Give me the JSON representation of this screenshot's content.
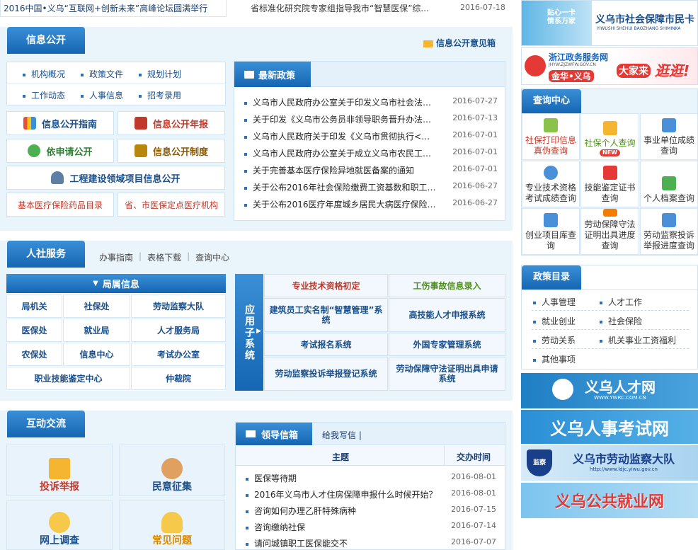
{
  "top": {
    "left_headline": "2016中国•义乌“互联网+创新未来”高峰论坛圆满举行",
    "mid_news": {
      "title": "省标准化研究院专家组指导我市“智慧医保”综...",
      "date": "2016-07-18"
    }
  },
  "info_public": {
    "title": "信息公开",
    "mailbox": "信息公开意见箱",
    "links_row1": [
      "机构概况",
      "政策文件",
      "规划计划"
    ],
    "links_row2": [
      "工作动态",
      "人事信息",
      "招考录用"
    ],
    "buttons": {
      "guide": "信息公开指南",
      "annual": "信息公开年报",
      "apply": "依申请公开",
      "system": "信息公开制度",
      "construction": "工程建设领域项目信息公开",
      "drug_catalog": "基本医疗保险药品目录",
      "hospitals": "省、市医保定点医疗机构"
    }
  },
  "latest_policy": {
    "title": "最新政策",
    "items": [
      {
        "title": "义乌市人民政府办公室关于印发义乌市社会法人...",
        "date": "2016-07-27"
      },
      {
        "title": "关于印发《义乌市公务员非领导职务晋升办法（...",
        "date": "2016-07-13"
      },
      {
        "title": "义乌市人民政府关于印发《义乌市贯彻执行<浙...",
        "date": "2016-07-01"
      },
      {
        "title": "义乌市人民政府办公室关于成立义乌市农民工工...",
        "date": "2016-07-01"
      },
      {
        "title": "关于完善基本医疗保险异地就医备案的通知",
        "date": "2016-07-01"
      },
      {
        "title": "关于公布2016年社会保险缴费工资基数和职工基...",
        "date": "2016-06-27"
      },
      {
        "title": "关于公布2016医疗年度城乡居民大病医疗保险起...",
        "date": "2016-06-27"
      }
    ]
  },
  "service": {
    "title": "人社服务",
    "links": [
      "办事指南",
      "表格下载",
      "查询中心"
    ],
    "bureau": {
      "title": "局属信息",
      "cells": [
        "局机关",
        "社保处",
        "劳动监察大队",
        "医保处",
        "就业局",
        "人才服务局",
        "农保处",
        "信息中心",
        "考试办公室",
        "职业技能鉴定中心",
        "仲裁院"
      ]
    },
    "subsystems": {
      "label": "应用子系统",
      "cells": [
        "专业技术资格初定",
        "工伤事故信息录入",
        "建筑员工实名制“智慧管理”系统",
        "高技能人才申报系统",
        "考试报名系统",
        "外国专家管理系统",
        "劳动监察投诉举报登记系统",
        "劳动保障守法证明出具申请系统"
      ]
    }
  },
  "interaction": {
    "title": "互动交流",
    "tiles": [
      "投诉举报",
      "民意征集",
      "网上调查",
      "常见问题"
    ],
    "mailbox": {
      "title": "领导信箱",
      "write": "给我写信",
      "col_subject": "主题",
      "col_time": "交办时间",
      "rows": [
        {
          "subject": "医保等待期",
          "time": "2016-08-01"
        },
        {
          "subject": "2016年义乌市人才住房保障申报什么时候开始？",
          "time": "2016-08-01"
        },
        {
          "subject": "咨询如何办理乙肝特殊病种",
          "time": "2016-07-15"
        },
        {
          "subject": "咨询缴纳社保",
          "time": "2016-07-14"
        },
        {
          "subject": "请问城镇职工医保能交不",
          "time": "2016-07-07"
        }
      ]
    }
  },
  "right": {
    "banner_card": {
      "slogan1": "贴心一卡",
      "slogan2": "情系万家",
      "name": "义乌市社会保障市民卡",
      "pinyin": "YIWUSHI SHEHUI BAOZHANG SHIMINKA"
    },
    "banner_zjzw": {
      "name": "浙江政务服务网",
      "url": "JHYW.ZJZWFW.GOV.CN",
      "region": "金华•义乌",
      "slogan1": "大家来",
      "slogan2": "逛逛!"
    },
    "query_center": {
      "title": "查询中心",
      "cells": [
        "社保打印信息真伪查询",
        "社保个人查询",
        "事业单位成绩查询",
        "专业技术资格考试成绩查询",
        "技能鉴定证书查询",
        "个人档案查询",
        "创业项目库查询",
        "劳动保障守法证明出具进度查询",
        "劳动监察投诉举报进度查询"
      ],
      "new_badge": "NEW"
    },
    "policy_catalog": {
      "title": "政策目录",
      "items": [
        "人事管理",
        "人才工作",
        "就业创业",
        "社会保险",
        "劳动关系",
        "机关事业工资福利",
        "其他事项"
      ]
    },
    "banners": {
      "talent": "义乌人才网",
      "talent_url": "WWW.YWRC.COM.CN",
      "exam": "义乌人事考试网",
      "labor": "义乌市劳动监察大队",
      "labor_url": "http://www.ldjc.yiwu.gov.cn",
      "labor_badge": "监察",
      "employment": "义乌公共就业网"
    }
  }
}
